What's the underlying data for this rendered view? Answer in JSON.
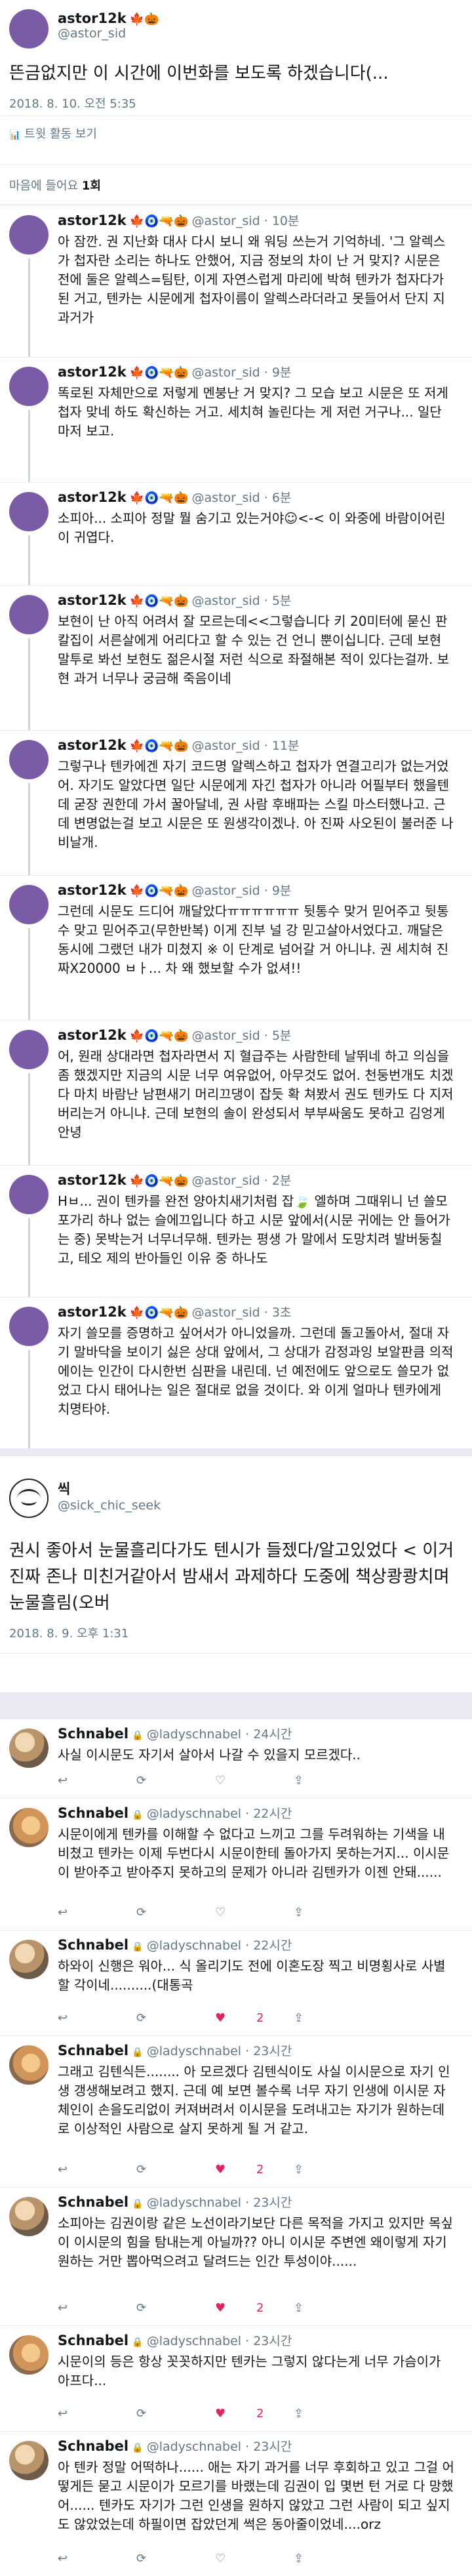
{
  "top_tweet": {
    "display_name": "astor12k",
    "handle": "@astor_sid",
    "emoji": "🍁🎃",
    "text": "뜬금없지만 이 시간에 이번화를 보도록 하겠습니다(...",
    "timestamp": "2018. 8. 10. 오전 5:35",
    "activity_label": "트윗 활동 보기",
    "likes_prefix": "마음에 들어요 ",
    "likes_count": "1회"
  },
  "icons": {
    "reply": "↩",
    "retweet": "⟳",
    "like": "♡",
    "liked": "♥",
    "share": "⇪",
    "chart": "📊",
    "lock": "🔒"
  },
  "replies": [
    {
      "display_name": "astor12k",
      "emoji": "🍁🧿🔫🎃",
      "handle": "@astor_sid",
      "time": "10분",
      "text": "아 잠깐. 권 지난화 대사 다시 보니 왜 워딩 쓰는거 기억하네. '그 알렉스가 첩자란 소리는 하나도 안했어, 지금 정보의 차이 난 거 맞지? 시문은 전에 둘은 알렉스=팀탄, 이게 자연스럽게 마리에 박혀 텐카가 첩자다가 된 거고, 텐카는 시문에게 첩자이름이 알렉스라더라고 못들어서 단지 지 과거가"
    },
    {
      "display_name": "astor12k",
      "emoji": "🍁🧿🔫🎃",
      "handle": "@astor_sid",
      "time": "9분",
      "text": "똑로된 자체만으로 저렇게 멘붕난 거 맞지? 그 모습 보고 시문은 또 저게 첩자 맞네 하도 확신하는 거고. 세치혀 놀린다는 게 저런 거구나... 일단 마저 보고."
    },
    {
      "display_name": "astor12k",
      "emoji": "🍁🧿🔫🎃",
      "handle": "@astor_sid",
      "time": "6분",
      "text": "소피아... 소피아 정말 뭘 숨기고 있는거야☺<-< 이 와중에 바람이어린이 귀엽다."
    },
    {
      "display_name": "astor12k",
      "emoji": "🍁🧿🔫🎃",
      "handle": "@astor_sid",
      "time": "5분",
      "text": "보현이 난 아직 어려서 잘 모르는데<<그렇습니다 키 20미터에 묻신 판 칼집이 서른살에게 어리다고 할 수 있는 건 언니 뿐이십니다. 근데 보현 말투로 봐선 보현도 젊은시절 저런 식으로 좌절해본 적이 있다는걸까. 보현 과거 너무나 궁금해 죽음이네"
    },
    {
      "display_name": "astor12k",
      "emoji": "🍁🧿🔫🎃",
      "handle": "@astor_sid",
      "time": "11분",
      "text": "그렇구나 텐카에겐 자기 코드명 알렉스하고 첩자가 연결고리가 없는거었어. 자기도 알았다면 일단 시문에게 자긴 첩자가 아니라 어필부터 했을텐데 굳장 권한데 가서 꿀아달네, 권 사람 후배파는 스킬 마스터했나고. 근데 변명없는걸 보고 시문은 또 원생각이겠나. 아 진짜 사오된이 불러준 나비날개."
    },
    {
      "display_name": "astor12k",
      "emoji": "🍁🧿🔫🎃",
      "handle": "@astor_sid",
      "time": "9분",
      "text": "그런데 시문도 드디어 깨달았다ㅠㅠㅠㅠㅠㅠ 뒷통수 맞거 믿어주고 뒷통수 맞고 믿어주고(무한반복) 이게 진부 널 강 믿고살아서었다고. 깨달은 동시에 그랬던 내가 미쳤지 ※ 이 단계로 넘어갈 거 아니냐. 권 세치혀 진짜X20000 ㅂㅏ... 차 왜 했보할 수가 없셔!!"
    },
    {
      "display_name": "astor12k",
      "emoji": "🍁🧿🔫🎃",
      "handle": "@astor_sid",
      "time": "5분",
      "text": "어, 원래 상대라면 첩자라면서 지 혈급주는 사람한테 날뛰네 하고 의심을 좀 했겠지만 지금의 시문 너무 여유없어, 아무것도 없어. 천둥번개도 치겠다 마치 바람난 남편새기 머리끄댕이 잡듯 확 쳐봤서 권도 텐카도 다 지저버리는거 아니냐. 근데 보현의 솔이 완성되서 부부싸움도 못하고 김엉게 안녕"
    },
    {
      "display_name": "astor12k",
      "emoji": "🍁🧿🔫🎃",
      "handle": "@astor_sid",
      "time": "2분",
      "text": "Hㅂ... 권이 텐카를 완전 양아치새기처럼 잡🍃 엘하며 그때위니 넌 쓸모포가리 하나 없는 슬에끄입니다 하고 시문 앞에서(시문 귀에는 안 들어가는 중) 못박는거 너무너무해. 텐카는 평생 가 말에서 도망치려 발버둥칠고, 테오 제의 반아들인 이유 중 하나도"
    },
    {
      "display_name": "astor12k",
      "emoji": "🍁🧿🔫🎃",
      "handle": "@astor_sid",
      "time": "3초",
      "text": "자기 쓸모를 증명하고 싶어서가 아니었을까. 그런데 돌고돌아서, 절대 자기 말바닥을 보이기 싫은 상대 앞에서, 그 상대가 감정과잉 보알판큼 의적에이는 인간이 다시한번 심판을 내린데. 넌 예전에도 앞으로도 쓸모가 없었고 다시 태어나는 일은 절대로 없을 것이다. 와 이게 얼마나 텐카에게 치명타야."
    }
  ],
  "mid_tweet": {
    "display_name": "씩",
    "handle": "@sick_chic_seek",
    "text": "권시 좋아서 눈물흘리다가도 텐시가 들젰다/알고있었다 < 이거 진짜 존나 미친거같아서 밤새서 과제하다 도중에 책상쾅쾅치며 눈물흘림(오버",
    "timestamp": "2018. 8. 9. 오후 1:31"
  },
  "schnabel_replies": [
    {
      "display_name": "Schnabel",
      "handle": "@ladyschnabel",
      "time": "24시간",
      "text": "사실 이시문도 자기서 살아서 나갈 수 있을지 모르겠다..",
      "likes": "",
      "liked": false
    },
    {
      "display_name": "Schnabel",
      "handle": "@ladyschnabel",
      "time": "22시간",
      "text": "시문이에게 텐카를 이해할 수 없다고 느끼고 그를 두려워하는 기색을 내비쳤고 텐카는 이제 두번다시 시문이한테 돌아가지 못하는거지... 이시문이 받아주고 받아주지 못하고의 문제가 아니라 김텐카가 이젠 안돼......",
      "likes": "",
      "liked": false
    },
    {
      "display_name": "Schnabel",
      "handle": "@ladyschnabel",
      "time": "22시간",
      "text": "하와이 신행은 워아... 식 올리기도 전에 이혼도장 찍고 비명횡사로 사별할 각이네..........(대통곡",
      "likes": "2",
      "liked": true
    },
    {
      "display_name": "Schnabel",
      "handle": "@ladyschnabel",
      "time": "23시간",
      "text": "그래고 김텐식든........ 아 모르겠다 김텐식이도 사실 이시문으로 자기 인생 갱생해보려고 했지. 근데 예 보면 볼수록 너무 자기 인생에 이시문 자체인이 손을도리없이 커져버려서 이시문을 도려내고는 자기가 원하는데로 이상적인 사람으로 살지 못하게 될 거 같고.",
      "likes": "2",
      "liked": true
    },
    {
      "display_name": "Schnabel",
      "handle": "@ladyschnabel",
      "time": "23시간",
      "text": "소피아는 김권이랑 같은 노선이라기보단 다른 목적을 가지고 있지만 목싶이 이시문의 힘을 탐내는게 아닐까?? 아니 이시문 주변엔 왜이렇게 자기 원하는 거만 뽑아먹으려고 달려드는 인간 투성이야......",
      "likes": "2",
      "liked": true
    },
    {
      "display_name": "Schnabel",
      "handle": "@ladyschnabel",
      "time": "23시간",
      "text": "시문이의 등은 항상 꼿꼿하지만 텐카는 그렇지 않다는게 너무 가슴이가 아프다...",
      "likes": "2",
      "liked": true
    },
    {
      "display_name": "Schnabel",
      "handle": "@ladyschnabel",
      "time": "23시간",
      "text": "아 텐카 정말 어떡하나...... 애는 자기 과거를 너무 후회하고 있고 그걸 어떻게든 묻고 시문이가 모르기를 바랬는데 김권이 입 몇번 턴 거로 다 망했어...... 텐카도 자기가 그런 인생을 원하지 않았고 그런 사람이 되고 싶지도 않았었는데 하필이면 잡았던게 썩은 동아줄이었네....orz",
      "likes": "",
      "liked": false
    }
  ]
}
